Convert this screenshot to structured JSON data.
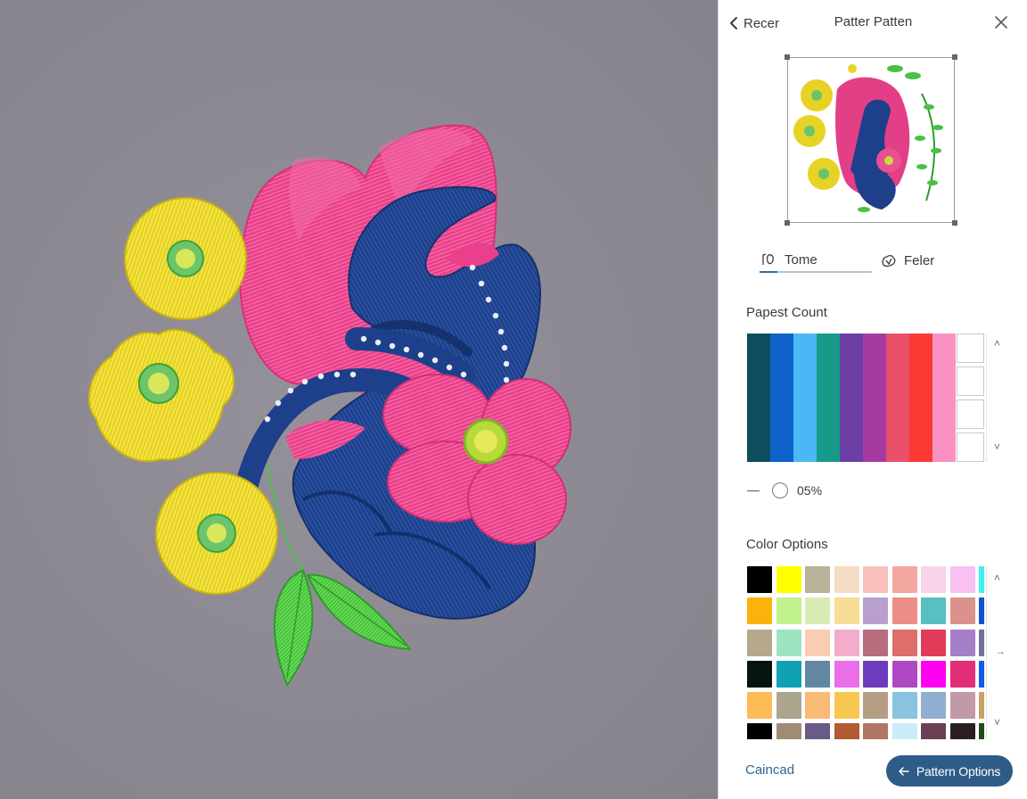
{
  "header": {
    "back_label": "Recer",
    "title": "Patter Patten",
    "back_icon": "chevron-left-icon",
    "close_icon": "close-icon"
  },
  "tabs": [
    {
      "label": "Tome",
      "icon": "tone-icon",
      "active": true
    },
    {
      "label": "Feler",
      "icon": "filter-icon",
      "active": false
    }
  ],
  "preset_section": {
    "label": "Papest Count",
    "palette_colors": [
      "#0f4c5c",
      "#0d63c9",
      "#4ab8f4",
      "#169a8a",
      "#6b3fa6",
      "#a63aa3",
      "#e8506b",
      "#fb3a35",
      "#fb91c2"
    ],
    "empty_slots": 4
  },
  "opacity": {
    "value": "05%"
  },
  "color_options": {
    "label": "Color Options",
    "swatches": [
      "#000000",
      "#ffff00",
      "#b8b398",
      "#f5dcc2",
      "#f9c0bb",
      "#f3a7a0",
      "#f9d3ea",
      "#f8c0f3",
      "#3df0f2",
      "#fbb20c",
      "#c2f28c",
      "#d7ebb5",
      "#f5dd95",
      "#b99fcd",
      "#ec8d88",
      "#58c0c3",
      "#db918c",
      "#0f54d5",
      "#b5a88a",
      "#9ee3c2",
      "#f8cdb1",
      "#f2adcc",
      "#b66d7e",
      "#dd6e6a",
      "#e23b5a",
      "#a57fc8",
      "#6f729e",
      "#061410",
      "#0fa1b4",
      "#6287a3",
      "#ea6ee8",
      "#6c3cbd",
      "#b148c3",
      "#ff00f0",
      "#e42d78",
      "#0d5cf0",
      "#fdbc56",
      "#aba68e",
      "#f8ba74",
      "#f7c84f",
      "#b69e85",
      "#88c4df",
      "#8faed0",
      "#c29aa6",
      "#c99f63",
      "#000000",
      "#a08c75",
      "#6b5a86",
      "#b25a33",
      "#b07565",
      "#c9edf6",
      "#6b3f56",
      "#2a1e22",
      "#1f4d14"
    ]
  },
  "footer": {
    "cancel_label": "Caincad",
    "primary_label": "Pattern Options",
    "primary_icon": "arrow-left-icon"
  }
}
